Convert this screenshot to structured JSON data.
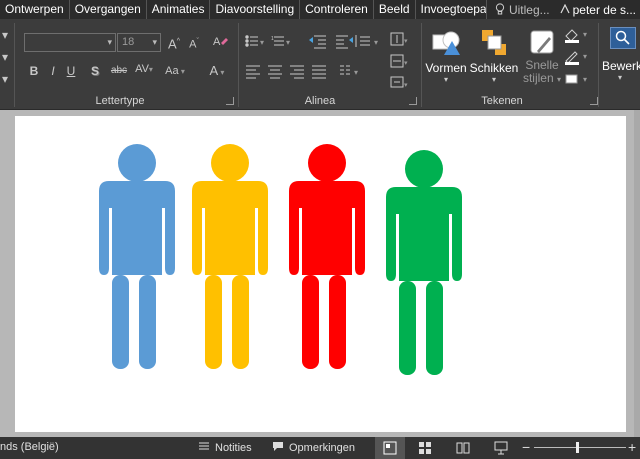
{
  "tabs": [
    "Ontwerpen",
    "Overgangen",
    "Animaties",
    "Diavoorstelling",
    "Controleren",
    "Beeld",
    "Invoegtoepassing"
  ],
  "help": {
    "label": "Uitleg..."
  },
  "user": {
    "label": "peter de s..."
  },
  "font": {
    "name_value": "",
    "size_value": "18"
  },
  "groups": {
    "lettertype": "Lettertype",
    "alinea": "Alinea",
    "tekenen": "Tekenen"
  },
  "drawing": {
    "vormen": "Vormen",
    "schikken": "Schikken",
    "snelle_line1": "Snelle",
    "snelle_line2": "stijlen"
  },
  "edit": {
    "label": "Bewerk"
  },
  "format": {
    "bold": "B",
    "italic": "I",
    "underline": "U",
    "shadow": "S",
    "strike": "abc",
    "spacing": "AV",
    "case": "Aa",
    "grow": "A",
    "shrink": "A",
    "color": "A"
  },
  "status": {
    "language": "nds (België)",
    "notes": "Notities",
    "comments": "Opmerkingen"
  },
  "figures": [
    {
      "color": "#5b9bd5"
    },
    {
      "color": "#ffc000"
    },
    {
      "color": "#ff0000"
    },
    {
      "color": "#00b050"
    }
  ]
}
